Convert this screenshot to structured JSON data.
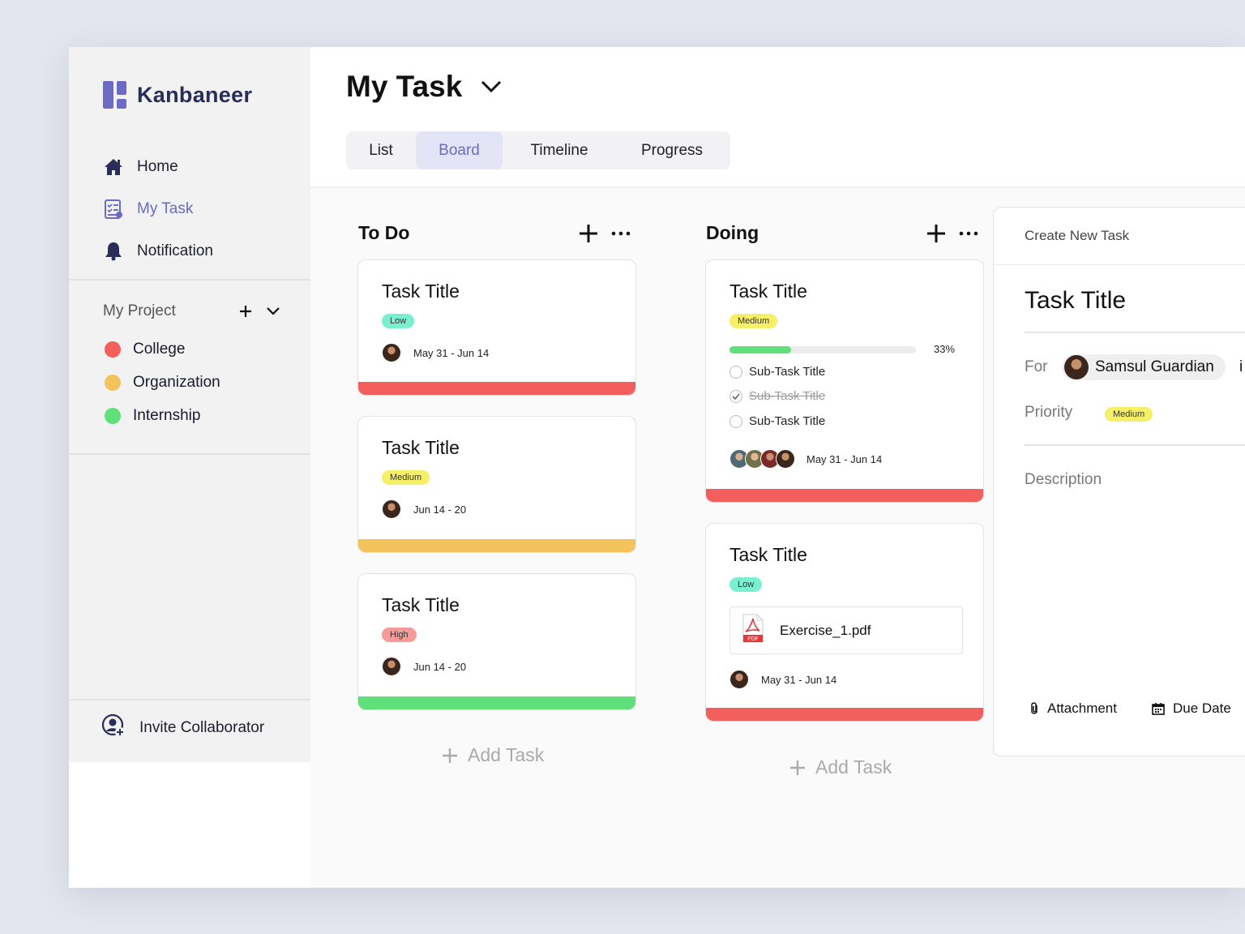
{
  "app": {
    "name": "Kanbaneer"
  },
  "sidebar": {
    "nav": [
      {
        "label": "Home",
        "icon": "home-icon"
      },
      {
        "label": "My Task",
        "icon": "task-list-icon",
        "active": true
      },
      {
        "label": "Notification",
        "icon": "bell-icon"
      }
    ],
    "projects_heading": "My Project",
    "projects": [
      {
        "label": "College",
        "color": "#f25f5c"
      },
      {
        "label": "Organization",
        "color": "#f5c35b"
      },
      {
        "label": "Internship",
        "color": "#5fe07a"
      }
    ],
    "invite_label": "Invite Collaborator"
  },
  "header": {
    "title": "My Task",
    "tabs": [
      {
        "label": "List"
      },
      {
        "label": "Board",
        "active": true
      },
      {
        "label": "Timeline"
      },
      {
        "label": "Progress"
      }
    ]
  },
  "board": {
    "columns": [
      {
        "title": "To Do",
        "add_task_label": "Add Task",
        "cards": [
          {
            "title": "Task Title",
            "priority": "Low",
            "dates": "May 31 - Jun 14",
            "stripe": "#f25f5c"
          },
          {
            "title": "Task Title",
            "priority": "Medium",
            "dates": "Jun 14 - 20",
            "stripe": "#f5c35b"
          },
          {
            "title": "Task Title",
            "priority": "High",
            "dates": "Jun 14 - 20",
            "stripe": "#5fe07a"
          }
        ]
      },
      {
        "title": "Doing",
        "add_task_label": "Add Task",
        "cards": [
          {
            "title": "Task Title",
            "priority": "Medium",
            "progress": 0.33,
            "progress_label": "33%",
            "subtasks": [
              {
                "label": "Sub-Task Title",
                "done": false
              },
              {
                "label": "Sub-Task Title",
                "done": true
              },
              {
                "label": "Sub-Task Title",
                "done": false
              }
            ],
            "dates": "May 31 - Jun 14",
            "stripe": "#f25f5c"
          },
          {
            "title": "Task Title",
            "priority": "Low",
            "attachment": "Exercise_1.pdf",
            "attachment_type": "PDF",
            "dates": "May 31 - Jun 14",
            "stripe": "#f25f5c"
          }
        ]
      }
    ]
  },
  "new_task_panel": {
    "heading": "Create New Task",
    "title": "Task Title",
    "for_label": "For",
    "assignee": "Samsul Guardian",
    "assignee_trailing": "i",
    "priority_label": "Priority",
    "priority": "Medium",
    "description_label": "Description",
    "attachment_label": "Attachment",
    "due_date_label": "Due Date"
  }
}
